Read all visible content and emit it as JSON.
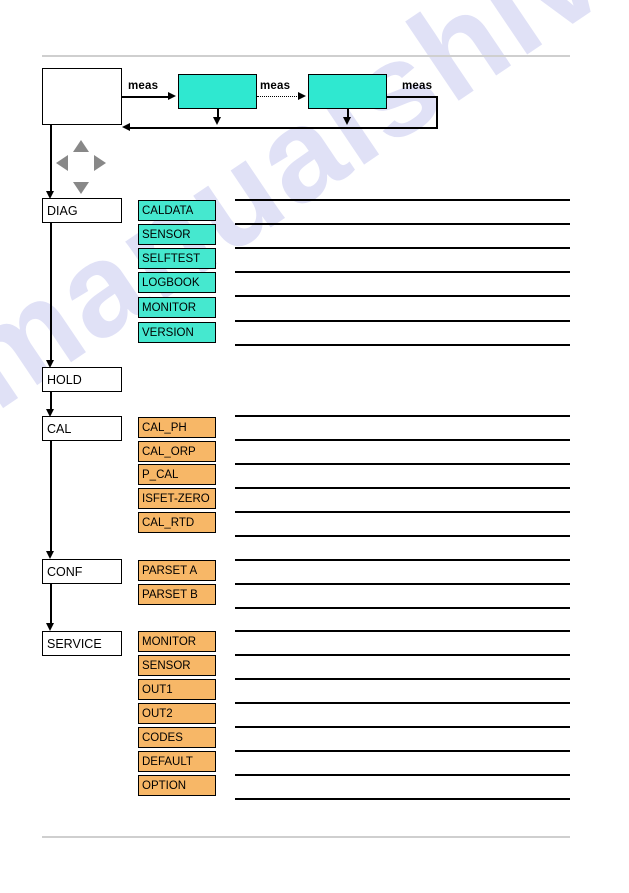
{
  "page": {
    "watermark": "manualshive.com",
    "rules": {
      "top_label": "top-divider",
      "bottom_label": "bottom-divider"
    }
  },
  "flow": {
    "measure_box_label": "",
    "display_box_1_label": "",
    "display_box_2_label": "",
    "meas_labels": [
      "meas",
      "meas",
      "meas"
    ]
  },
  "navpad": {
    "up": "arrow-up",
    "down": "arrow-down",
    "left": "arrow-left",
    "right": "arrow-right"
  },
  "menu": {
    "groups": [
      {
        "name": "DIAG",
        "color": "#45e8cf",
        "items": [
          "CALDATA",
          "SENSOR",
          "SELFTEST",
          "LOGBOOK",
          "MONITOR",
          "VERSION"
        ]
      },
      {
        "name": "HOLD",
        "color": "",
        "items": []
      },
      {
        "name": "CAL",
        "color": "#f7b767",
        "items": [
          "CAL_PH",
          "CAL_ORP",
          "P_CAL",
          "ISFET-ZERO",
          "CAL_RTD"
        ]
      },
      {
        "name": "CONF",
        "color": "#f7b767",
        "items": [
          "PARSET A",
          "PARSET B"
        ]
      },
      {
        "name": "SERVICE",
        "color": "#f7b767",
        "items": [
          "MONITOR",
          "SENSOR",
          "OUT1",
          "OUT2",
          "CODES",
          "DEFAULT",
          "OPTION"
        ]
      }
    ]
  },
  "colors": {
    "cyan": "#45e8cf",
    "orange": "#f7b767",
    "rule_gray": "#cfcfcf",
    "navpad_gray": "#888888",
    "watermark": "#ced0f2"
  }
}
